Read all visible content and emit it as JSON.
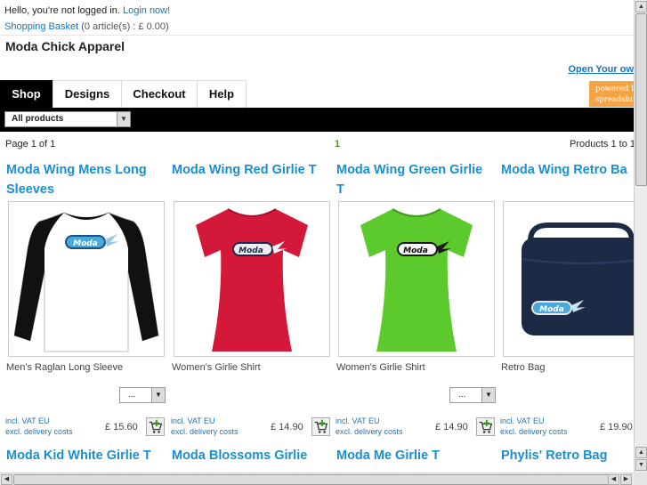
{
  "account": {
    "greeting": "Hello, you're not logged in.",
    "login_link": "Login now!",
    "basket_link": "Shopping Basket",
    "basket_summary": "(0 article(s) : £ 0.00)"
  },
  "site": {
    "title": "Moda Chick Apparel",
    "open_link": "Open Your ow",
    "powered_by_line1": "powered by",
    "powered_by_line2": "spreadshirt"
  },
  "nav": {
    "tabs": [
      {
        "label": "Shop",
        "active": true
      },
      {
        "label": "Designs",
        "active": false
      },
      {
        "label": "Checkout",
        "active": false
      },
      {
        "label": "Help",
        "active": false
      }
    ]
  },
  "filter": {
    "selected": "All products"
  },
  "pager": {
    "page_info": "Page 1 of 1",
    "current_page": "1",
    "products_info": "Products 1 to 1"
  },
  "products": [
    {
      "title": "Moda Wing Mens Long Sleeves",
      "type": "Men's Raglan Long Sleeve",
      "size_placeholder": "...",
      "vat": "incl. VAT EU",
      "delivery": "excl. delivery costs",
      "price": "£ 15.60",
      "color": "#ffffff",
      "sleeve_color": "#111111"
    },
    {
      "title": "Moda Wing Red Girlie T",
      "type": "Women's Girlie Shirt",
      "vat": "incl. VAT EU",
      "delivery": "excl. delivery costs",
      "price": "£ 14.90",
      "color": "#d3183a"
    },
    {
      "title": "Moda Wing Green Girlie T",
      "type": "Women's Girlie Shirt",
      "size_placeholder": "...",
      "vat": "incl. VAT EU",
      "delivery": "excl. delivery costs",
      "price": "£ 14.90",
      "color": "#5cc92c"
    },
    {
      "title": "Moda Wing Retro Ba",
      "type": "Retro Bag",
      "vat": "incl. VAT EU",
      "delivery": "excl. delivery costs",
      "price": "£ 19.90",
      "color": "#1c2a45"
    }
  ],
  "products_row2": [
    {
      "title": "Moda Kid White Girlie T"
    },
    {
      "title": "Moda Blossoms Girlie"
    },
    {
      "title": "Moda Me Girlie T"
    },
    {
      "title": "Phylis' Retro Bag"
    }
  ],
  "logo_text": "Moda",
  "icons": {
    "dropdown": "chevron-down-icon",
    "cart": "add-to-basket-icon",
    "scroll_up": "arrow-up-icon",
    "scroll_down": "arrow-down-icon",
    "scroll_left": "arrow-left-icon",
    "scroll_right": "arrow-right-icon"
  },
  "colors": {
    "link": "#1a73b8",
    "product_title": "#1a8fd0",
    "active_tab": "#000000",
    "powered_badge": "#f5a347",
    "current_page": "#3a9c1a"
  }
}
